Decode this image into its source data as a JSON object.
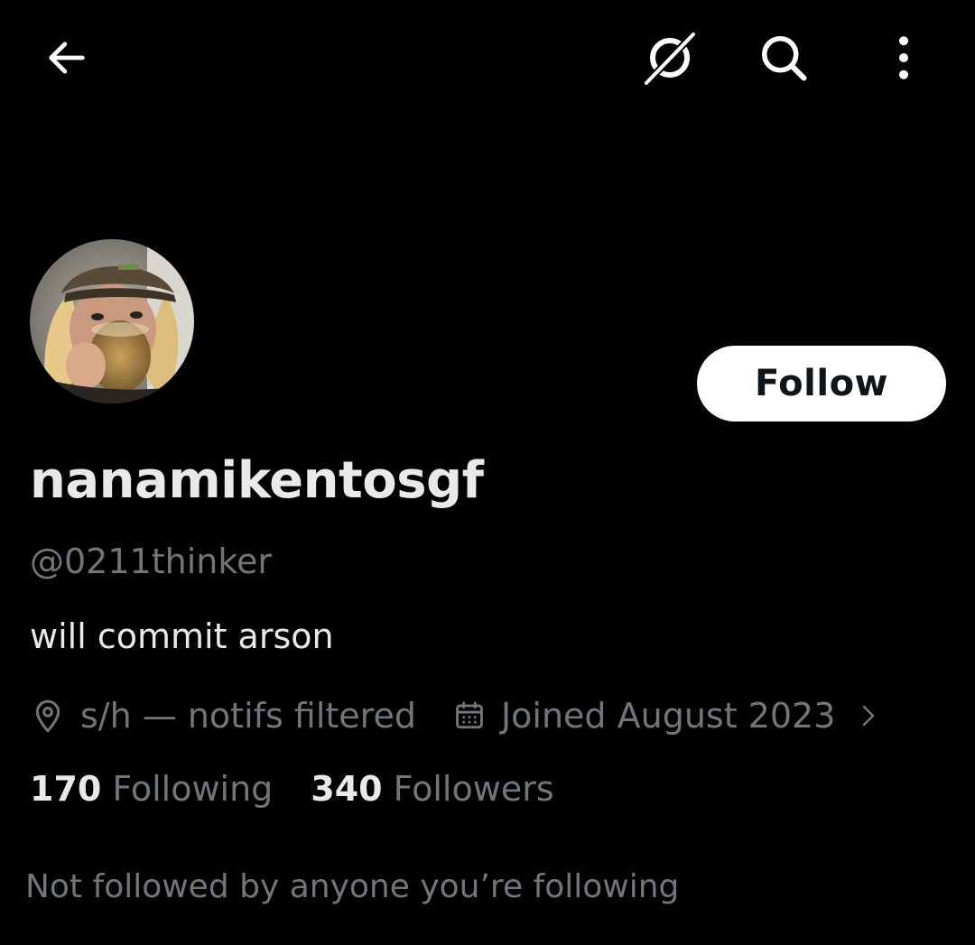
{
  "topbar": {
    "back_icon": "arrow-left-icon",
    "grok_icon": "grok-icon",
    "search_icon": "search-icon",
    "more_icon": "more-vertical-icon"
  },
  "profile": {
    "display_name": "nanamikentosgf",
    "handle": "@0211thinker",
    "bio": "will commit arson",
    "location": "s/h — notifs filtered",
    "joined": "Joined August 2023",
    "following_count": "170",
    "following_label": "Following",
    "followers_count": "340",
    "followers_label": "Followers",
    "not_followed_text": "Not followed by anyone you’re following"
  },
  "actions": {
    "follow_label": "Follow"
  },
  "colors": {
    "background": "#000000",
    "primary_text": "#e7e9ea",
    "secondary_text": "#71767b",
    "button_bg": "#ffffff",
    "button_text": "#0f1419"
  }
}
